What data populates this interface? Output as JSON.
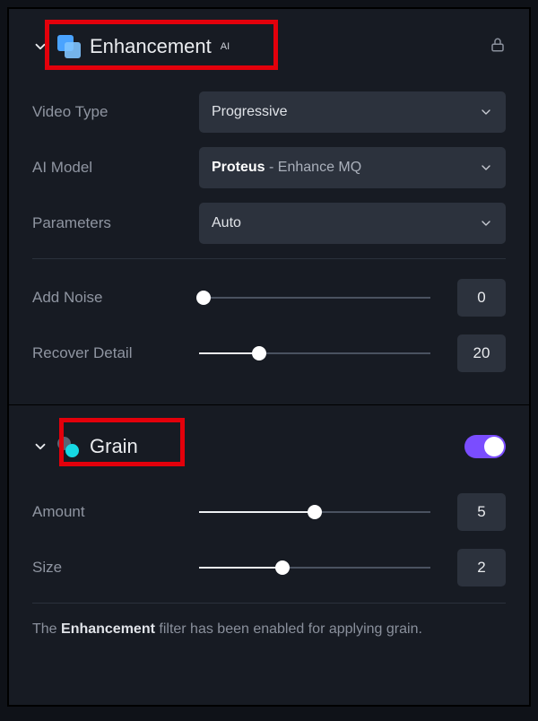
{
  "enhancement": {
    "title": "Enhancement",
    "title_sup": "AI",
    "video_type_label": "Video Type",
    "video_type_value": "Progressive",
    "ai_model_label": "AI Model",
    "ai_model_value_main": "Proteus",
    "ai_model_value_sub": " - Enhance MQ",
    "parameters_label": "Parameters",
    "parameters_value": "Auto",
    "add_noise_label": "Add Noise",
    "add_noise_value": "0",
    "recover_detail_label": "Recover Detail",
    "recover_detail_value": "20"
  },
  "grain": {
    "title": "Grain",
    "amount_label": "Amount",
    "amount_value": "5",
    "size_label": "Size",
    "size_value": "2"
  },
  "footer": {
    "pre": "The ",
    "bold": "Enhancement",
    "post": " filter has been enabled for applying grain."
  }
}
